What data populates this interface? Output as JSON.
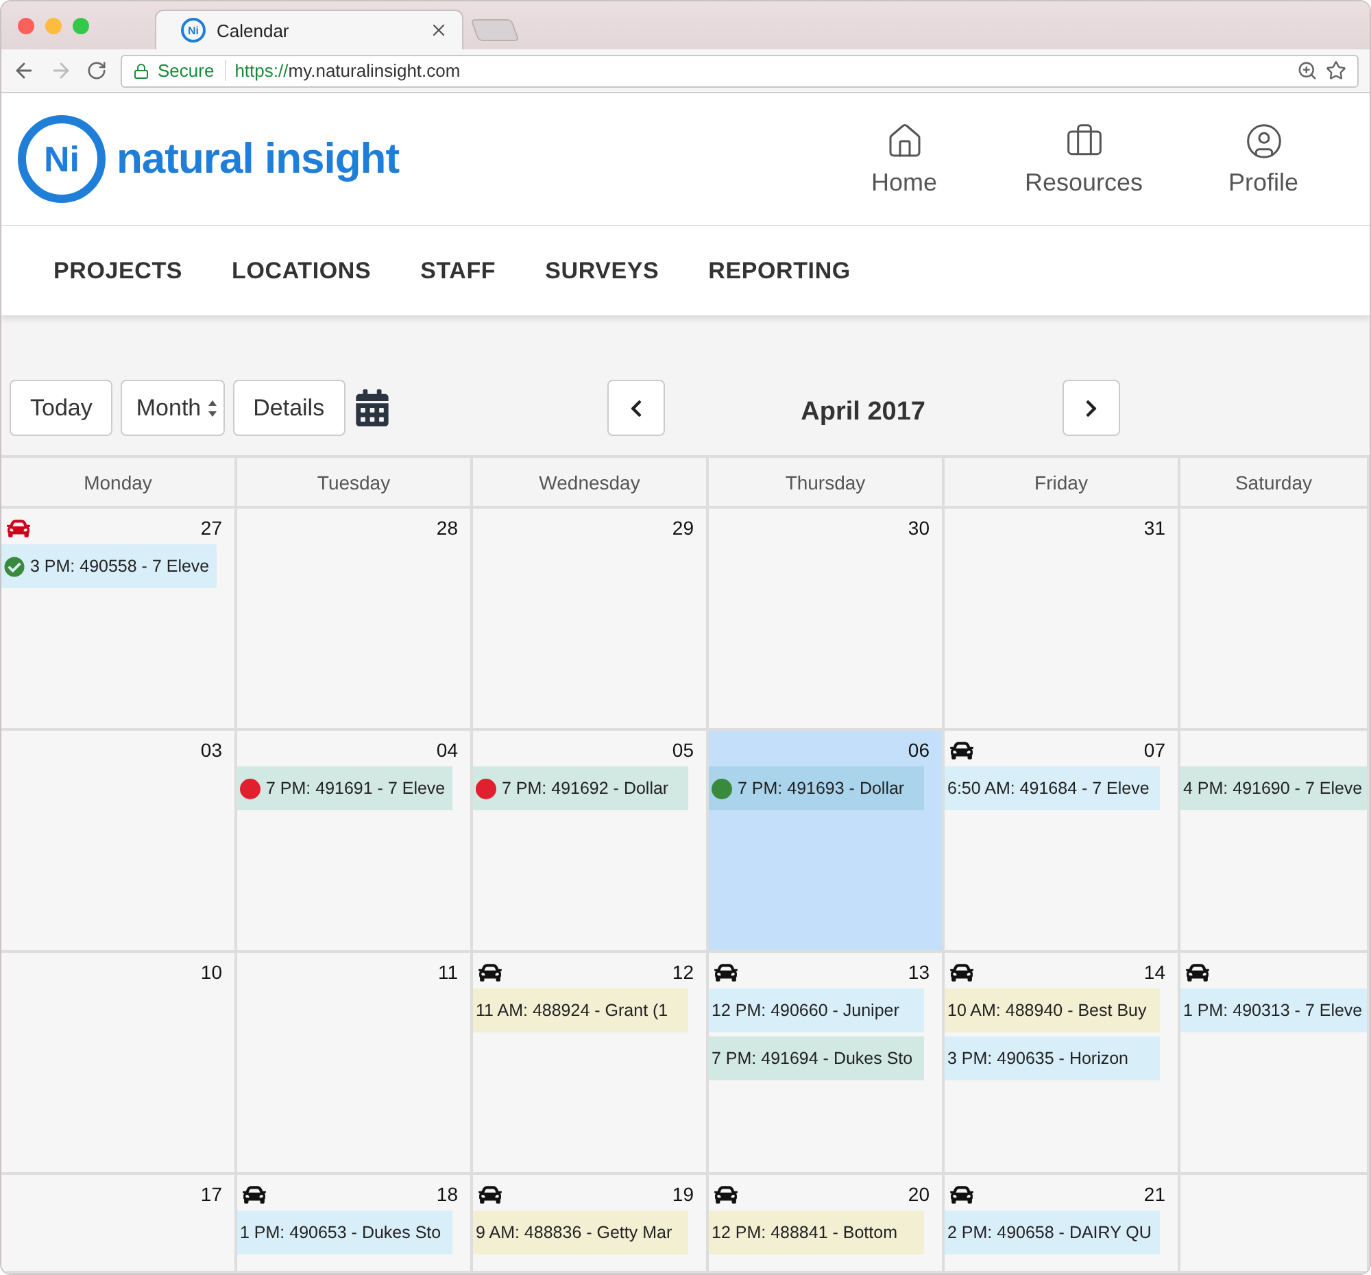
{
  "browser": {
    "tab": {
      "favicon_text": "Ni",
      "title": "Calendar"
    },
    "security": "Secure",
    "url_scheme": "https://",
    "url_host": "my.naturalinsight.com"
  },
  "brand": {
    "mark": "Ni",
    "name": "natural insight"
  },
  "header_links": [
    {
      "label": "Home",
      "kind": "home"
    },
    {
      "label": "Resources",
      "kind": "resources"
    },
    {
      "label": "Profile",
      "kind": "profile"
    }
  ],
  "menu": [
    "PROJECTS",
    "LOCATIONS",
    "STAFF",
    "SURVEYS",
    "REPORTING"
  ],
  "toolbar": {
    "today": "Today",
    "view": "Month",
    "details": "Details",
    "title": "April 2017"
  },
  "weekdays": [
    "Monday",
    "Tuesday",
    "Wednesday",
    "Thursday",
    "Friday",
    "Saturday"
  ],
  "weeks": [
    {
      "days": [
        {
          "date": "27",
          "selected": false,
          "car": {
            "color": "#d0021b"
          },
          "events": [
            {
              "text": "3 PM: 490558 - 7 Eleve",
              "color": "#d8eef8",
              "marker": {
                "kind": "check",
                "color": "#3a8a3e"
              }
            }
          ]
        },
        {
          "date": "28",
          "selected": false
        },
        {
          "date": "29",
          "selected": false
        },
        {
          "date": "30",
          "selected": false
        },
        {
          "date": "31",
          "selected": false
        },
        {
          "selected": false
        }
      ]
    },
    {
      "days": [
        {
          "date": "03",
          "selected": false
        },
        {
          "date": "04",
          "selected": false,
          "events": [
            {
              "text": "7 PM: 491691 - 7 Eleve",
              "color": "#d2e8e3",
              "marker": {
                "kind": "dot",
                "color": "#e0202e"
              }
            }
          ]
        },
        {
          "date": "05",
          "selected": false,
          "events": [
            {
              "text": "7 PM: 491692 - Dollar",
              "color": "#d2e8e3",
              "marker": {
                "kind": "dot",
                "color": "#e0202e"
              }
            }
          ]
        },
        {
          "date": "06",
          "selected": true,
          "events": [
            {
              "text": "7 PM: 491693 - Dollar",
              "color": "#a9d4ec",
              "marker": {
                "kind": "dot",
                "color": "#3a8a3e"
              }
            }
          ]
        },
        {
          "date": "07",
          "selected": false,
          "car": {
            "color": "#111111"
          },
          "events": [
            {
              "text": "6:50 AM: 491684 - 7 Eleve",
              "color": "#d8eef8"
            }
          ]
        },
        {
          "selected": false,
          "events": [
            {
              "text": "4 PM: 491690 - 7 Eleve",
              "color": "#d2e8e3"
            }
          ]
        }
      ]
    },
    {
      "days": [
        {
          "date": "10",
          "selected": false
        },
        {
          "date": "11",
          "selected": false
        },
        {
          "date": "12",
          "selected": false,
          "car": {
            "color": "#111111"
          },
          "events": [
            {
              "text": "11 AM: 488924 - Grant (1",
              "color": "#f2efd2"
            }
          ]
        },
        {
          "date": "13",
          "selected": false,
          "car": {
            "color": "#111111"
          },
          "events": [
            {
              "text": "12 PM: 490660 - Juniper",
              "color": "#d8eef8"
            },
            {
              "text": "7 PM: 491694 - Dukes Sto",
              "color": "#d2e8e3"
            }
          ]
        },
        {
          "date": "14",
          "selected": false,
          "car": {
            "color": "#111111"
          },
          "events": [
            {
              "text": "10 AM: 488940 - Best Buy",
              "color": "#f2efd2"
            },
            {
              "text": "3 PM: 490635 - Horizon",
              "color": "#d8eef8"
            }
          ]
        },
        {
          "selected": false,
          "car": {
            "color": "#111111"
          },
          "events": [
            {
              "text": "1 PM: 490313 - 7 Eleve",
              "color": "#d8eef8"
            }
          ]
        }
      ]
    },
    {
      "days": [
        {
          "date": "17",
          "selected": false
        },
        {
          "date": "18",
          "selected": false,
          "car": {
            "color": "#111111"
          },
          "events": [
            {
              "text": "1 PM: 490653 - Dukes Sto",
              "color": "#d8eef8"
            }
          ]
        },
        {
          "date": "19",
          "selected": false,
          "car": {
            "color": "#111111"
          },
          "events": [
            {
              "text": "9 AM: 488836 - Getty Mar",
              "color": "#f2efd2"
            }
          ]
        },
        {
          "date": "20",
          "selected": false,
          "car": {
            "color": "#111111"
          },
          "events": [
            {
              "text": "12 PM: 488841 - Bottom",
              "color": "#f2efd2"
            }
          ]
        },
        {
          "date": "21",
          "selected": false,
          "car": {
            "color": "#111111"
          },
          "events": [
            {
              "text": "2 PM: 490658 - DAIRY QU",
              "color": "#d8eef8"
            }
          ]
        },
        {
          "selected": false
        }
      ]
    }
  ]
}
